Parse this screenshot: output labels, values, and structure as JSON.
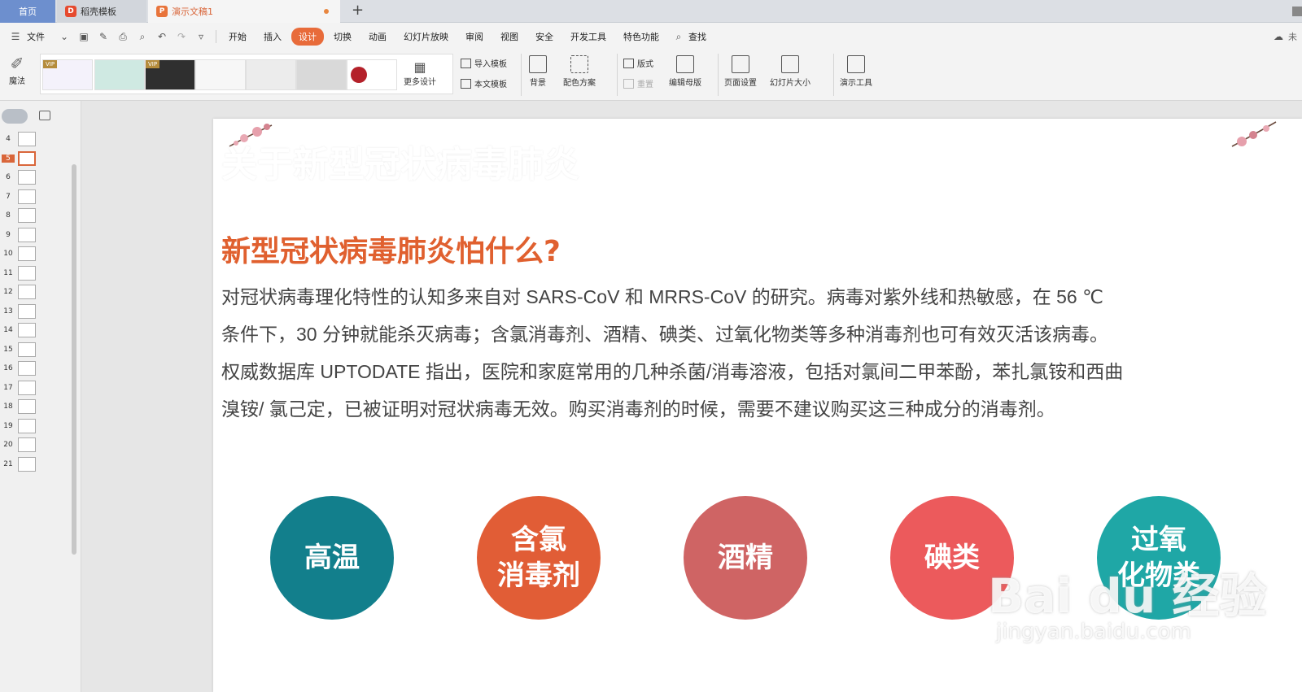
{
  "tabs": {
    "home": "首页",
    "templates": "稻壳模板",
    "document": "演示文稿1",
    "add": "+"
  },
  "menu": {
    "file": "文件",
    "items": [
      "开始",
      "插入",
      "设计",
      "切换",
      "动画",
      "幻灯片放映",
      "审阅",
      "视图",
      "安全",
      "开发工具",
      "特色功能"
    ],
    "active_index": 2,
    "search": "查找",
    "sync": "未"
  },
  "ribbon": {
    "magic": "魔法",
    "more_design": "更多设计",
    "import_template": "导入模板",
    "this_template": "本文模板",
    "background": "背景",
    "color_scheme": "配色方案",
    "layout": "版式",
    "reset": "重置",
    "edit_master": "编辑母版",
    "page_setup": "页面设置",
    "slide_size": "幻灯片大小",
    "present_tools": "演示工具",
    "vip": "VIP"
  },
  "slides_panel": {
    "numbers": [
      "4",
      "5",
      "6",
      "7",
      "8",
      "9",
      "10",
      "11",
      "12",
      "13",
      "14",
      "15",
      "16",
      "17",
      "18",
      "19",
      "20",
      "21"
    ],
    "current": "5"
  },
  "slide": {
    "ghost_title": "关于新型冠状病毒肺炎",
    "heading": "新型冠状病毒肺炎怕什么?",
    "body_lines": [
      "对冠状病毒理化特性的认知多来自对 SARS-CoV 和 MRRS-CoV 的研究。病毒对紫外线和热敏感，在 56 ℃",
      "条件下，30 分钟就能杀灭病毒；含氯消毒剂、酒精、碘类、过氧化物类等多种消毒剂也可有效灭活该病毒。",
      "权威数据库 UPTODATE 指出，医院和家庭常用的几种杀菌/消毒溶液，包括对氯间二甲苯酚，苯扎氯铵和西曲",
      "溴铵/ 氯己定，已被证明对冠状病毒无效。购买消毒剂的时候，需要不建议购买这三种成分的消毒剂。"
    ],
    "circles": [
      {
        "label": "高温",
        "color": "#127f8c"
      },
      {
        "label": "含氯\n消毒剂",
        "color": "#e15d36"
      },
      {
        "label": "酒精",
        "color": "#cf6464"
      },
      {
        "label": "碘类",
        "color": "#ec5a5c"
      },
      {
        "label": "过氧\n化物类",
        "color": "#1fa7a6"
      }
    ],
    "watermark": "Bai du 经验",
    "watermark_url": "jingyan.baidu.com"
  }
}
